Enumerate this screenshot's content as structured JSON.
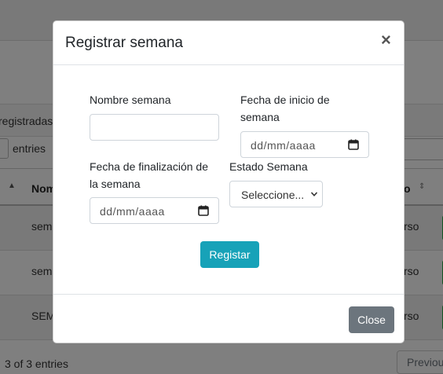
{
  "background": {
    "registradas_text": "registradas",
    "entries_label": "entries",
    "table": {
      "header_col1": "Nom",
      "header_col_right": "o",
      "rows": [
        {
          "col1": "sem",
          "col_right": "rso"
        },
        {
          "col1": "sem",
          "col_right": "rso"
        },
        {
          "col1": "SEM",
          "col_right": "rso"
        }
      ]
    },
    "footer_info": "3 of 3 entries",
    "previous_label": "Previous"
  },
  "modal": {
    "title": "Registrar semana",
    "close_icon": "×",
    "fields": {
      "nombre_label": "Nombre semana",
      "nombre_value": "",
      "fecha_inicio_label": "Fecha de inicio de semana",
      "fecha_inicio_placeholder": "dd/mm/aaaa",
      "fecha_fin_label": "Fecha de finalización de la semana",
      "fecha_fin_placeholder": "dd/mm/aaaa",
      "estado_label": "Estado Semana",
      "estado_selected": "Seleccione..."
    },
    "register_button": "Registar",
    "close_button": "Close"
  }
}
